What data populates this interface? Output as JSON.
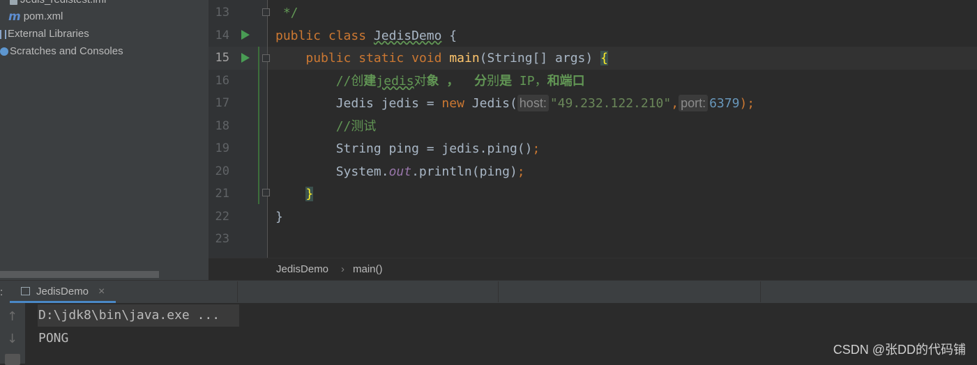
{
  "project_tree": {
    "items": [
      {
        "label": "Jedis_redistest.iml",
        "icon": "iml-file-icon"
      },
      {
        "label": "pom.xml",
        "icon": "maven-icon",
        "icon_glyph": "m"
      },
      {
        "label": "External Libraries",
        "icon": "library-icon"
      },
      {
        "label": "Scratches and Consoles",
        "icon": "scratches-icon"
      }
    ]
  },
  "editor": {
    "line_numbers": [
      "13",
      "14",
      "15",
      "16",
      "17",
      "18",
      "19",
      "20",
      "21",
      "22",
      "23"
    ],
    "current_line": "15",
    "code": {
      "l13": " */",
      "l14_kw1": "public",
      "l14_kw2": "class",
      "l14_name": "JedisDemo",
      "l14_brace": "{",
      "l15_kw1": "public",
      "l15_kw2": "static",
      "l15_kw3": "void",
      "l15_name": "main",
      "l15_params": "(String[] args)",
      "l15_brace": "{",
      "l16_a": "//创",
      "l16_b": "建",
      "l16_c": "jedis",
      "l16_d": "对",
      "l16_e": "象 ，  分",
      "l16_f": "别",
      "l16_g": "是",
      "l16_h": " IP，",
      "l16_i": "和端口",
      "l17_a": "Jedis jedis = ",
      "l17_new": "new",
      "l17_b": " Jedis(",
      "l17_hint_host": "host:",
      "l17_str": "\"49.232.122.210\"",
      "l17_comma": ",",
      "l17_hint_port": "port:",
      "l17_num": "6379",
      "l17_end": ");",
      "l18": "//测试",
      "l19_a": "String ping = jedis.ping()",
      "l19_semi": ";",
      "l20_a": "System.",
      "l20_out": "out",
      "l20_b": ".println(ping)",
      "l20_semi": ";",
      "l21": "}",
      "l22": "}"
    }
  },
  "breadcrumb": {
    "items": [
      "JedisDemo",
      "main()"
    ],
    "separator": "›"
  },
  "run_panel": {
    "tab_label": "JedisDemo",
    "tab_close": "×",
    "prefix": ":",
    "console_lines": [
      "D:\\jdk8\\bin\\java.exe ...",
      "PONG"
    ]
  },
  "watermark": "CSDN @张DD的代码铺",
  "colors": {
    "keyword": "#cc7832",
    "function": "#ffc66d",
    "comment": "#629755",
    "string": "#6a8759",
    "number": "#6897bb",
    "field": "#9876aa",
    "accent": "#4a88c7"
  }
}
